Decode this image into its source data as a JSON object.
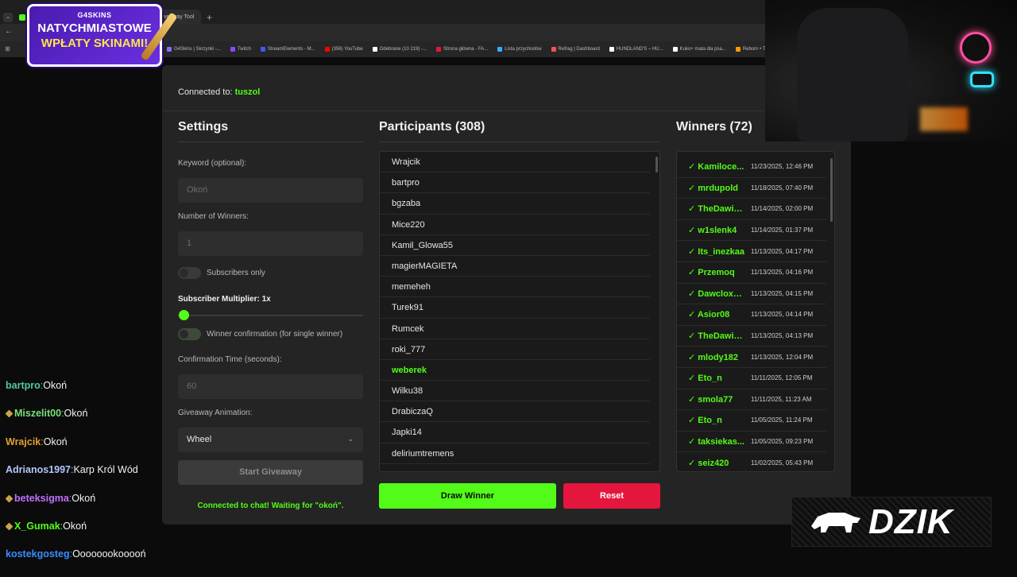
{
  "browser": {
    "active_tab": "Giveaway Tool",
    "bookmarks": [
      {
        "label": "G4Skins | Skrzynki -...",
        "color": "#8a6cff"
      },
      {
        "label": "Twitch",
        "color": "#9146ff"
      },
      {
        "label": "StreamElements - M...",
        "color": "#3a5bff"
      },
      {
        "label": "(356) YouTube",
        "color": "#ff0000"
      },
      {
        "label": "Odebrane (10 219) -...",
        "color": "#ffffff"
      },
      {
        "label": "Strona główna - FA...",
        "color": "#e5163d"
      },
      {
        "label": "Lista przychodów",
        "color": "#30b0ff"
      },
      {
        "label": "Refrag | Dashboard",
        "color": "#ff5050"
      },
      {
        "label": "HUNDLAND'S – HU...",
        "color": "#ffffff"
      },
      {
        "label": "Kuko+ mata dla psa...",
        "color": "#ffffff"
      },
      {
        "label": "Reborn • The Ho",
        "color": "#ff9900"
      }
    ]
  },
  "promo": {
    "brand": "G4SKINS",
    "line1": "NATYCHMIASTOWE",
    "line2": "WPŁATY SKINAMI!"
  },
  "app": {
    "connected_label": "Connected to:",
    "connected_user": "tuszol",
    "settings": {
      "title": "Settings",
      "keyword_label": "Keyword (optional):",
      "keyword_placeholder": "Okoń",
      "winners_label": "Number of Winners:",
      "winners_value": "1",
      "subs_only_label": "Subscribers only",
      "multiplier_label": "Subscriber Multiplier: 1x",
      "multiplier_value": 1,
      "confirm_toggle_label": "Winner confirmation (for single winner)",
      "confirm_time_label": "Confirmation Time (seconds):",
      "confirm_time_value": "60",
      "animation_label": "Giveaway Animation:",
      "animation_value": "Wheel",
      "start_button": "Start Giveaway",
      "status": "Connected to chat! Waiting for \"okoń\"."
    },
    "participants": {
      "title": "Participants (308)",
      "items": [
        {
          "name": "Wrajcik",
          "highlight": false
        },
        {
          "name": "bartpro",
          "highlight": false
        },
        {
          "name": "bgzaba",
          "highlight": false
        },
        {
          "name": "Mice220",
          "highlight": false
        },
        {
          "name": "Kamil_Glowa55",
          "highlight": false
        },
        {
          "name": "magierMAGIETA",
          "highlight": false
        },
        {
          "name": "memeheh",
          "highlight": false
        },
        {
          "name": "Turek91",
          "highlight": false
        },
        {
          "name": "Rumcek",
          "highlight": false
        },
        {
          "name": "roki_777",
          "highlight": false
        },
        {
          "name": "weberek",
          "highlight": true
        },
        {
          "name": "Wilku38",
          "highlight": false
        },
        {
          "name": "DrabiczaQ",
          "highlight": false
        },
        {
          "name": "Japki14",
          "highlight": false
        },
        {
          "name": "deliriumtremens",
          "highlight": false
        }
      ],
      "draw_button": "Draw Winner",
      "reset_button": "Reset"
    },
    "winners": {
      "title": "Winners (72)",
      "items": [
        {
          "name": "✓ Kamiloce...",
          "date": "11/23/2025, 12:46 PM"
        },
        {
          "name": "✓ mrdupold",
          "date": "11/18/2025, 07:40 PM"
        },
        {
          "name": "✓ TheDawid...",
          "date": "11/14/2025, 02:00 PM"
        },
        {
          "name": "✓ w1slenk4",
          "date": "11/14/2025, 01:37 PM"
        },
        {
          "name": "✓ Its_inezkaa",
          "date": "11/13/2025, 04:17 PM"
        },
        {
          "name": "✓ Przemoq",
          "date": "11/13/2025, 04:16 PM"
        },
        {
          "name": "✓ Dawclox11...",
          "date": "11/13/2025, 04:15 PM"
        },
        {
          "name": "✓ Asior08",
          "date": "11/13/2025, 04:14 PM"
        },
        {
          "name": "✓ TheDawidek",
          "date": "11/13/2025, 04:13 PM"
        },
        {
          "name": "✓ mlody182",
          "date": "11/13/2025, 12:04 PM"
        },
        {
          "name": "✓ Eto_n",
          "date": "11/11/2025, 12:05 PM"
        },
        {
          "name": "✓ smola77",
          "date": "11/11/2025, 11:23 AM"
        },
        {
          "name": "✓ Eto_n",
          "date": "11/05/2025, 11:24 PM"
        },
        {
          "name": "✓ taksiekas...",
          "date": "11/05/2025, 09:23 PM"
        },
        {
          "name": "✓ seiz420",
          "date": "11/02/2025, 05:43 PM"
        }
      ]
    }
  },
  "chat": [
    {
      "user": "bartpro",
      "color": "#53c8a0",
      "badge": false,
      "msg": "Okoń"
    },
    {
      "user": "Miszelit00",
      "color": "#7be07b",
      "badge": true,
      "msg": "Okoń"
    },
    {
      "user": "Wrajcik",
      "color": "#e0a030",
      "badge": false,
      "msg": "Okoń"
    },
    {
      "user": "Adrianos1997",
      "color": "#b0c8ff",
      "badge": false,
      "msg": "Karp Król Wód"
    },
    {
      "user": "beteksigma",
      "color": "#c070ff",
      "badge": true,
      "msg": "Okoń"
    },
    {
      "user": "X_Gumak",
      "color": "#53fc18",
      "badge": true,
      "msg": "Okoń"
    },
    {
      "user": "kostekgosteg",
      "color": "#3a8bff",
      "badge": false,
      "msg": "Oooooookooooń"
    }
  ],
  "logo": {
    "text": "DZIK"
  },
  "colors": {
    "accent": "#53fc18",
    "danger": "#e5163d",
    "panel": "#242424"
  }
}
